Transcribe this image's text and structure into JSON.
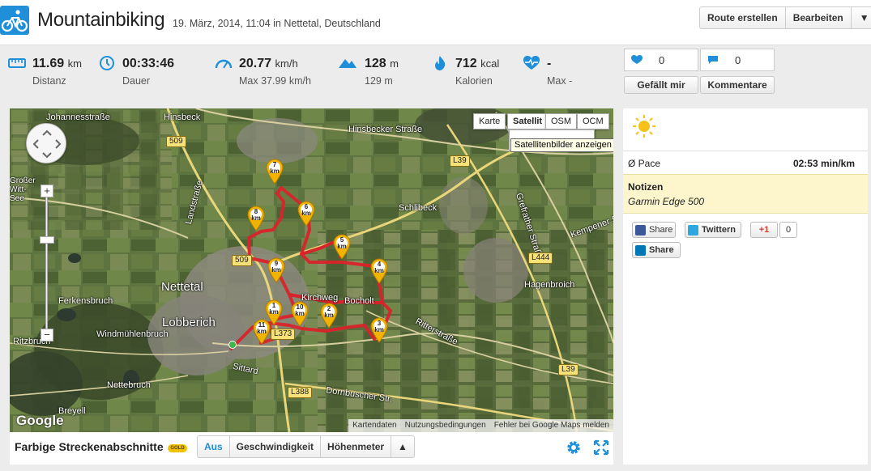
{
  "header": {
    "title": "Mountainbiking",
    "subtitle": "19. März, 2014, 11:04 in Nettetal, Deutschland",
    "buttons": {
      "create_route": "Route erstellen",
      "edit": "Bearbeiten",
      "more": "▼"
    },
    "logo_icon": "bike-icon"
  },
  "stats": [
    {
      "icon": "ruler-icon",
      "value": "11.69",
      "unit": "km",
      "label": "Distanz"
    },
    {
      "icon": "clock-icon",
      "value": "00:33:46",
      "unit": "",
      "label": "Dauer"
    },
    {
      "icon": "speed-icon",
      "value": "20.77",
      "unit": "km/h",
      "label": "Max 37.99 km/h"
    },
    {
      "icon": "mountain-icon",
      "value": "128",
      "unit": "m",
      "label": "129 m"
    },
    {
      "icon": "flame-icon",
      "value": "712",
      "unit": "kcal",
      "label": "Kalorien"
    },
    {
      "icon": "heartrate-icon",
      "value": "-",
      "unit": "",
      "label": "Max -"
    }
  ],
  "social": {
    "likes": {
      "count": "0",
      "button": "Gefällt mir"
    },
    "comments": {
      "count": "0",
      "button": "Kommentare"
    }
  },
  "map": {
    "types": [
      "Karte",
      "Satellit",
      "OSM",
      "OCM"
    ],
    "active_type": "Satellit",
    "tooltip": "Satellitenbilder anzeigen",
    "footer": [
      "Kartendaten",
      "Nutzungsbedingungen",
      "Fehler bei Google Maps melden"
    ],
    "logo": "Google",
    "places": [
      "Johannesstraße",
      "Hinsbeck",
      "Hinsbecker Straße",
      "Schlibeck",
      "Nettetal",
      "Lobberich",
      "Ferkensbruch",
      "Windmühlenbruch",
      "Ritzbruch",
      "Hagenbroich",
      "Nettebruch",
      "Großer Witt-See",
      "Bocholt",
      "Ritterstraße",
      "Grefrather Straße",
      "Landstraße",
      "Dornbuscher Str.",
      "Kempener Straße",
      "Breyell",
      "Sittard",
      "Kirchweg"
    ],
    "road_signs": [
      "509",
      "509",
      "L39",
      "L444",
      "L373",
      "L388",
      "L39"
    ],
    "km_markers": [
      "1",
      "2",
      "3",
      "4",
      "5",
      "6",
      "7",
      "8",
      "9",
      "10",
      "11"
    ],
    "km_unit": "km"
  },
  "map_bar": {
    "title": "Farbige Streckenabschnitte",
    "badge": "GOLD",
    "segments": [
      "Aus",
      "Geschwindigkeit",
      "Höhenmeter",
      "▲"
    ],
    "active_segment": "Aus"
  },
  "panel": {
    "weather_icon": "sun-icon",
    "pace_label": "Ø Pace",
    "pace_value": "02:53 min/km",
    "notes_title": "Notizen",
    "notes_text": "Garmin Edge 500",
    "share": {
      "facebook": "Share",
      "twitter": "Twittern",
      "gplus": "+1",
      "gplus_count": "0",
      "linkedin": "Share"
    }
  },
  "colors": {
    "accent": "#1e8fd8",
    "route": "#d9232b",
    "marker": "#f2b200",
    "notes_bg": "#fdf6cc"
  }
}
